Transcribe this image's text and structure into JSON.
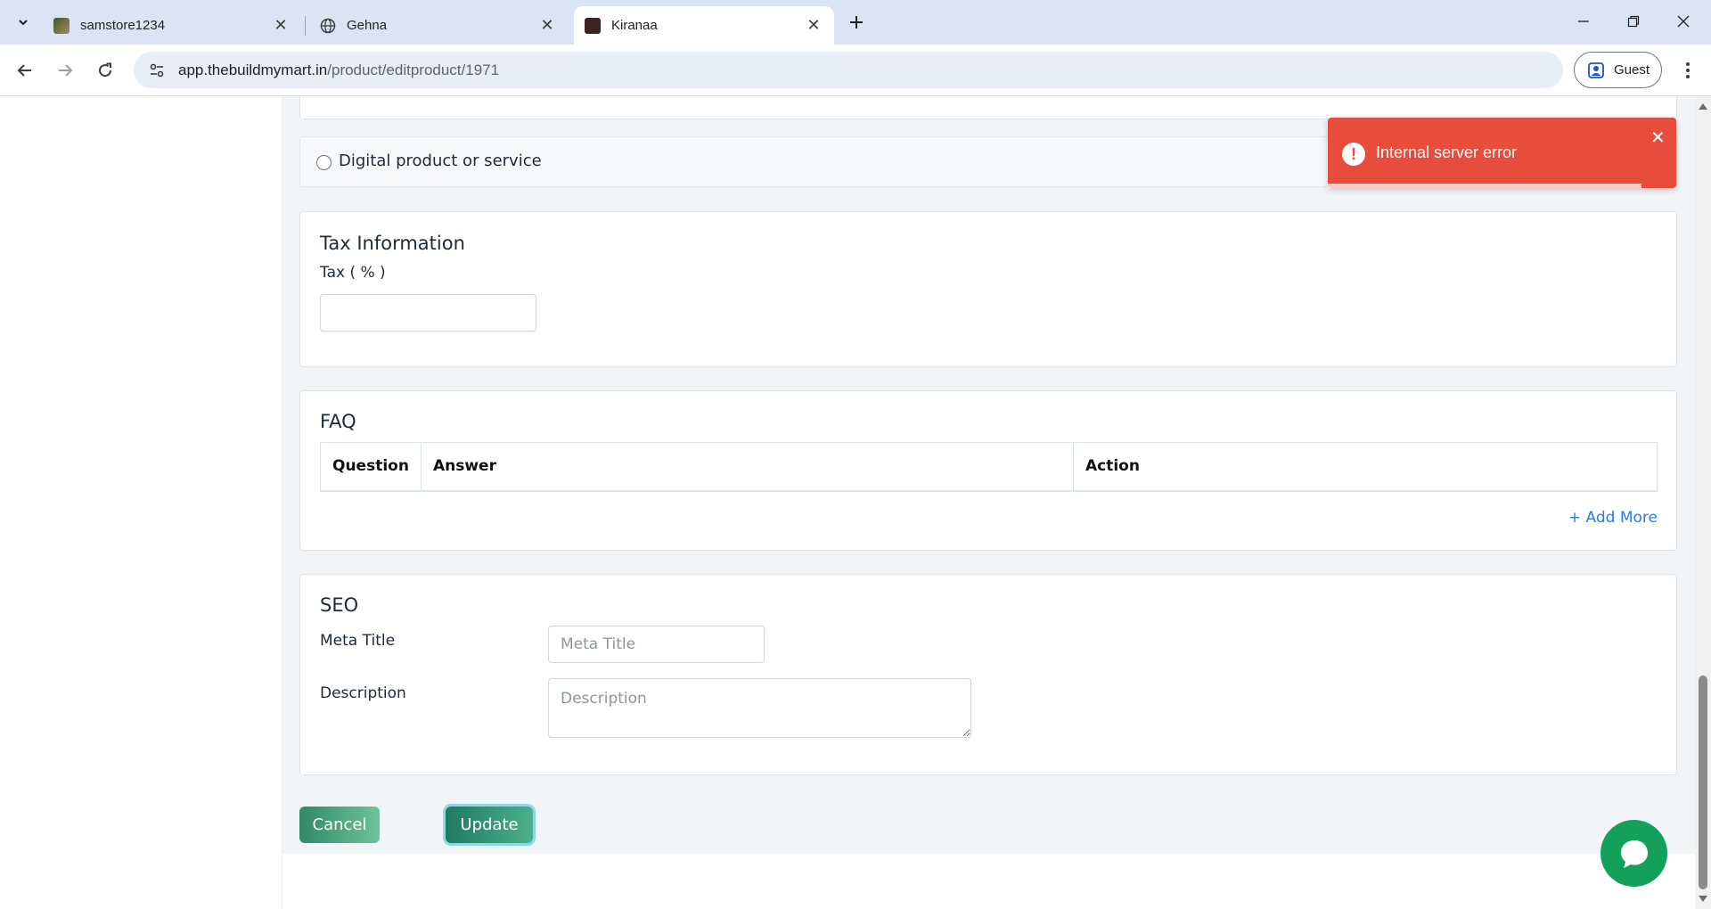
{
  "browser": {
    "tabs": [
      {
        "title": "samstore1234",
        "icon": "samstore-favicon",
        "active": false
      },
      {
        "title": "Gehna",
        "icon": "globe-icon",
        "active": false
      },
      {
        "title": "Kiranaa",
        "icon": "kiranaa-favicon",
        "active": true
      }
    ],
    "address": {
      "domain": "app.thebuildmymart.in",
      "path": "/product/editproduct/1971"
    },
    "profile_label": "Guest"
  },
  "form": {
    "digital_option_label": "Digital product or service",
    "tax": {
      "heading": "Tax Information",
      "label": "Tax ( % )",
      "value": ""
    },
    "faq": {
      "heading": "FAQ",
      "columns": [
        "Question",
        "Answer",
        "Action"
      ],
      "add_more_label": "+ Add More"
    },
    "seo": {
      "heading": "SEO",
      "meta_title_label": "Meta Title",
      "meta_title_placeholder": "Meta Title",
      "description_label": "Description",
      "description_placeholder": "Description"
    },
    "buttons": {
      "cancel": "Cancel",
      "update": "Update"
    }
  },
  "toast": {
    "message": "Internal server error",
    "type": "error",
    "color": "#e74c3c",
    "progress": 0.9
  },
  "colors": {
    "primary_button": "#1f7a63",
    "link": "#2a7be4",
    "chat": "#13a05a"
  }
}
